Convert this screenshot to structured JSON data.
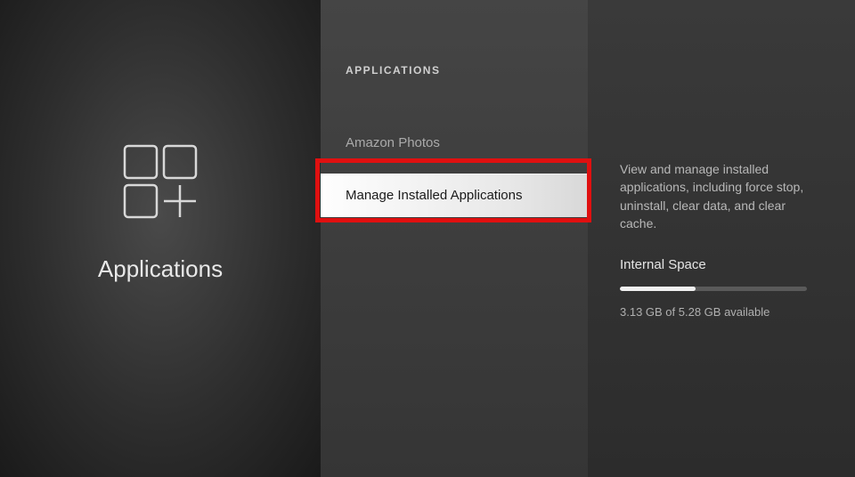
{
  "left": {
    "title": "Applications"
  },
  "middle": {
    "header": "APPLICATIONS",
    "items": [
      {
        "label": "Amazon Photos"
      },
      {
        "label": "Manage Installed Applications"
      }
    ]
  },
  "right": {
    "description": "View and manage installed applications, including force stop, uninstall, clear data, and clear cache.",
    "storage_label": "Internal Space",
    "storage_text": "3.13 GB of 5.28 GB available"
  }
}
